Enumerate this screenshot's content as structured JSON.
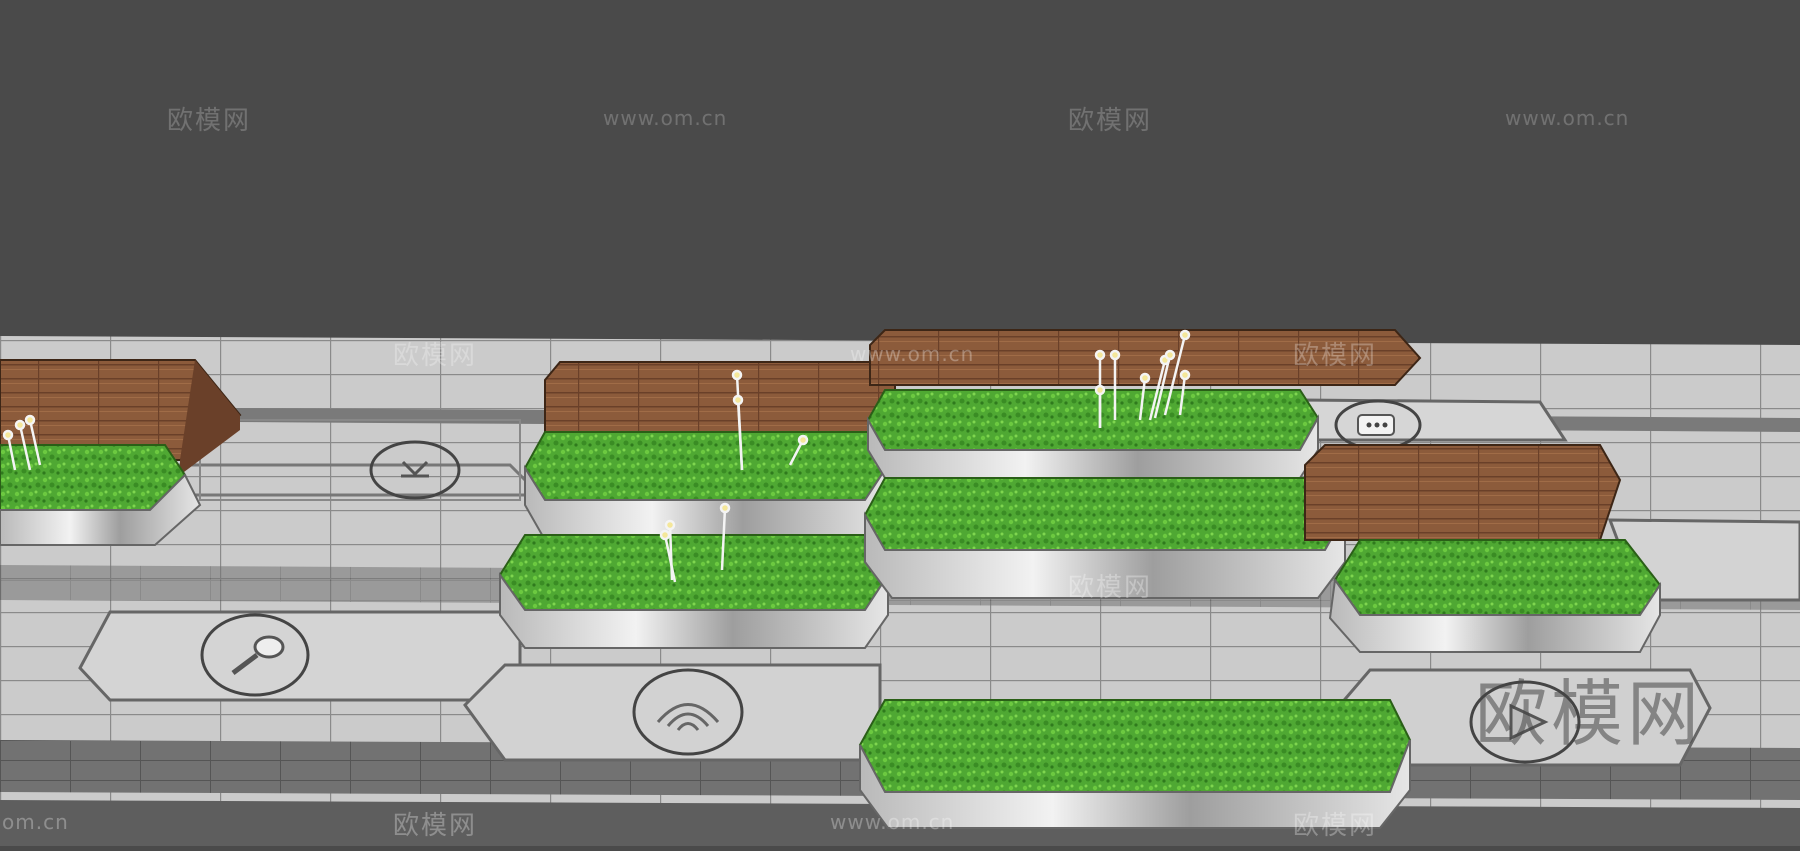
{
  "watermarks": {
    "brand": "欧模网",
    "url": "www.om.cn",
    "url_partial": "om.cn"
  },
  "colors": {
    "sky": "#4a4a4a",
    "paving": "#c9c9c9",
    "dark_band": "#6f6f6f",
    "grass": "#4aa531",
    "wood": "#8a5a3a",
    "steel": "#cfcfcf"
  },
  "icons": [
    "arrow-icon",
    "search-icon",
    "wifi-icon",
    "chat-icon",
    "play-icon"
  ]
}
